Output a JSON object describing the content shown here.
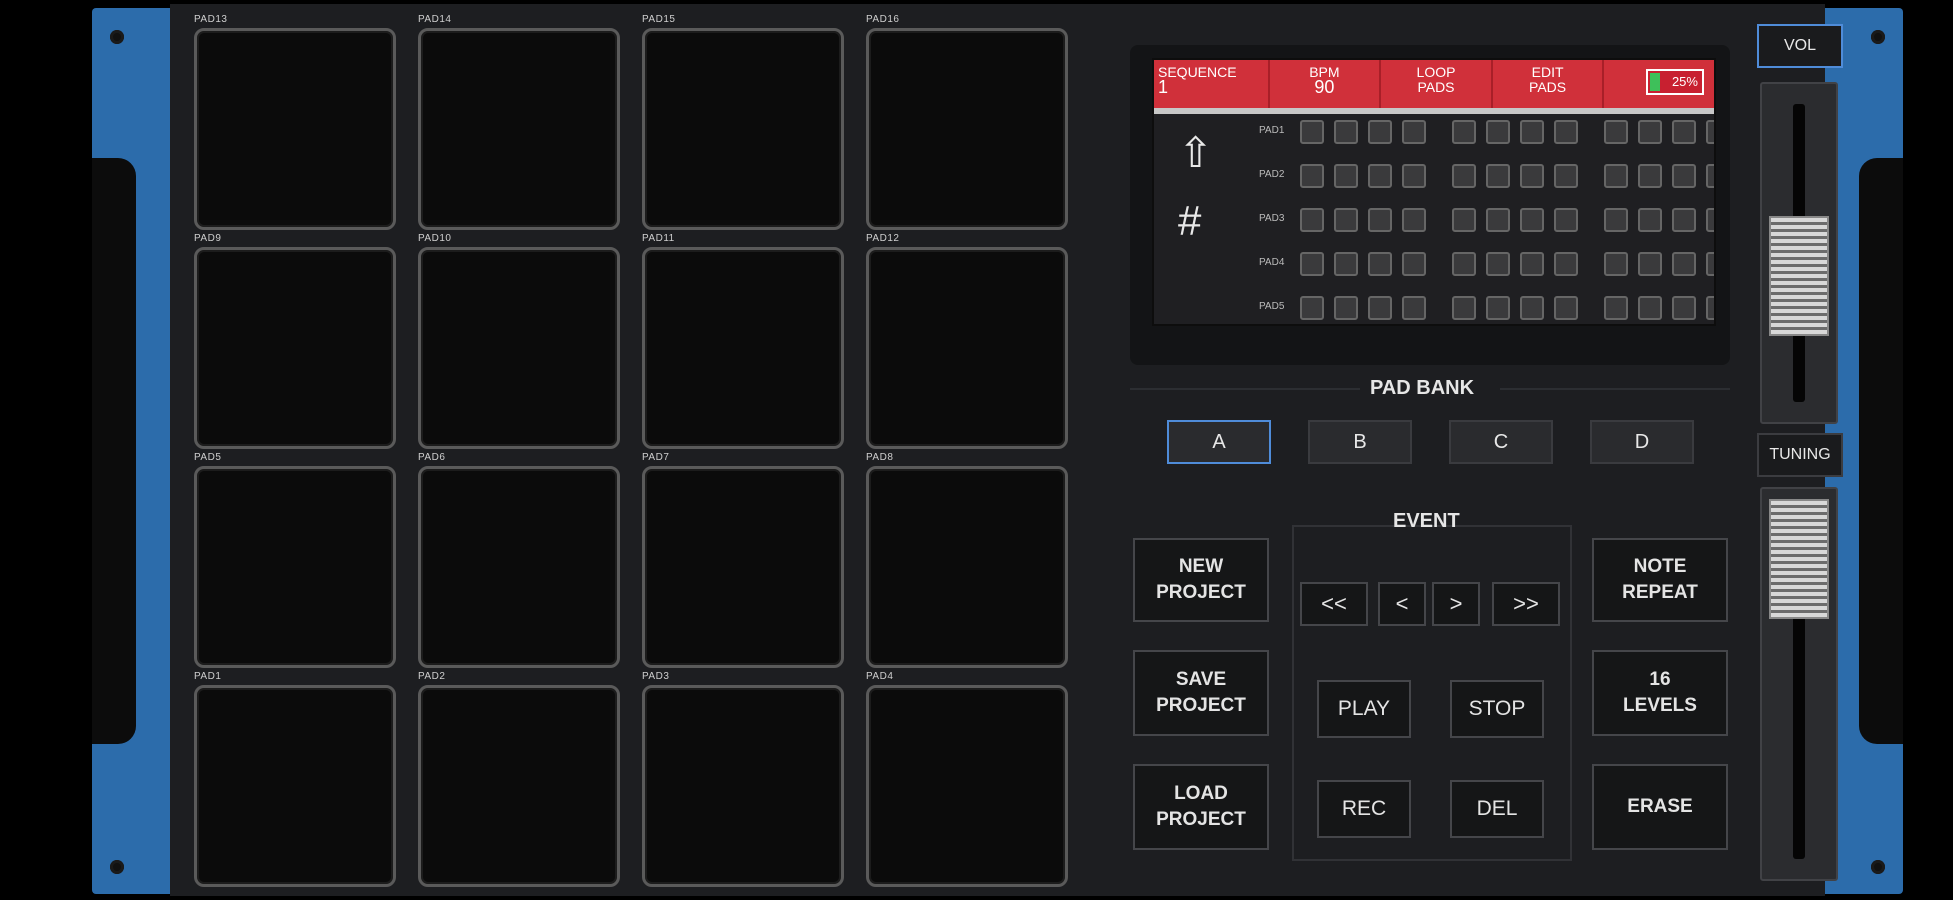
{
  "pads": [
    "PAD13",
    "PAD14",
    "PAD15",
    "PAD16",
    "PAD9",
    "PAD10",
    "PAD11",
    "PAD12",
    "PAD5",
    "PAD6",
    "PAD7",
    "PAD8",
    "PAD1",
    "PAD2",
    "PAD3",
    "PAD4"
  ],
  "screen": {
    "sequence_label": "SEQUENCE",
    "sequence_value": "1",
    "bpm_label": "BPM",
    "bpm_value": "90",
    "loop_pads_label": "LOOP\nPADS",
    "edit_pads_label": "EDIT\nPADS",
    "battery": "25%",
    "battery_level": 0.25,
    "rows": [
      "PAD1",
      "PAD2",
      "PAD3",
      "PAD4",
      "PAD5"
    ],
    "steps_per_row": 12
  },
  "pad_bank": {
    "title": "PAD BANK",
    "banks": [
      "A",
      "B",
      "C",
      "D"
    ],
    "active": "A"
  },
  "left_buttons": {
    "new_project": "NEW\nPROJECT",
    "save_project": "SAVE\nPROJECT",
    "load_project": "LOAD\nPROJECT"
  },
  "event": {
    "title": "EVENT",
    "rewind": "<<",
    "prev": "<",
    "next": ">",
    "forward": ">>",
    "play": "PLAY",
    "stop": "STOP",
    "rec": "REC",
    "del": "DEL"
  },
  "right_buttons": {
    "note_repeat": "NOTE\nREPEAT",
    "levels": "16\nLEVELS",
    "erase": "ERASE"
  },
  "side": {
    "vol": "VOL",
    "tuning": "TUNING"
  },
  "colors": {
    "accent_blue": "#2c6cab",
    "screen_red": "#d0303a",
    "battery_green": "#3ec05a"
  }
}
